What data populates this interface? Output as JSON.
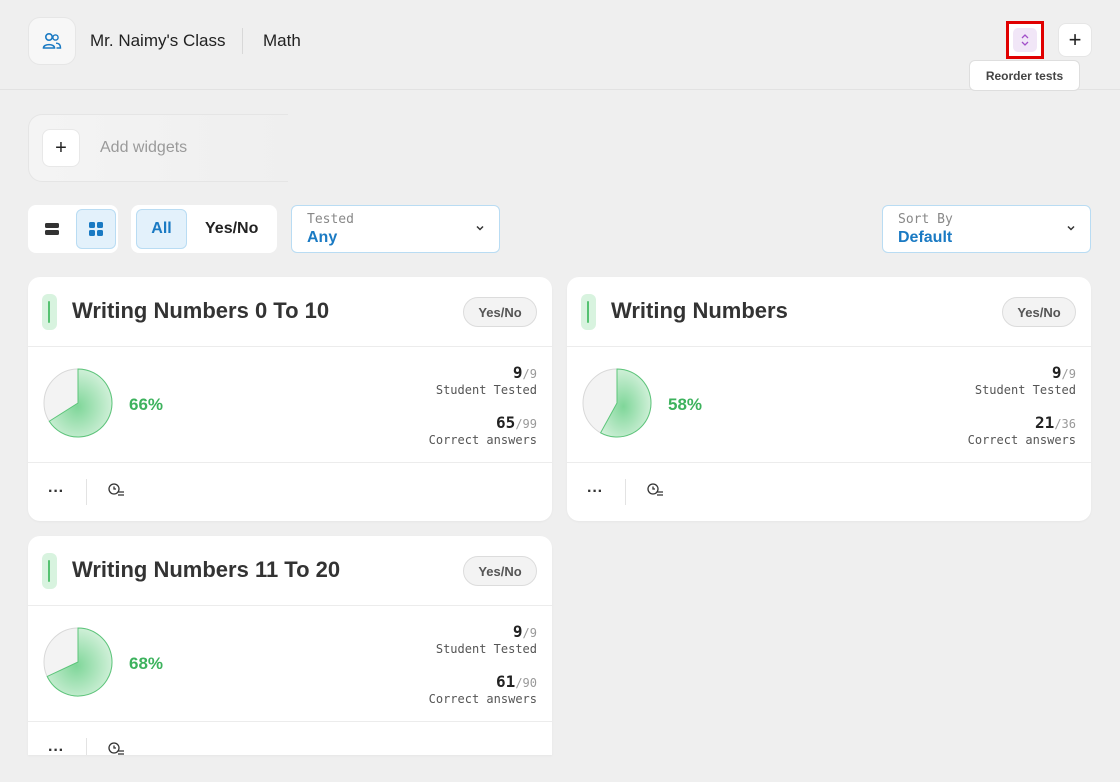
{
  "header": {
    "class_name": "Mr. Naimy's Class",
    "subject": "Math",
    "class_icon": "users-icon",
    "reorder_icon": "sort-vertical-icon",
    "reorder_tooltip": "Reorder tests",
    "add_label": "+"
  },
  "widgets": {
    "add_label": "+",
    "label": "Add widgets"
  },
  "filters": {
    "view_modes": [
      "list-view-icon",
      "grid-view-icon"
    ],
    "active_view": "grid",
    "type_options": [
      "All",
      "Yes/No"
    ],
    "active_type": "All",
    "tested": {
      "label": "Tested",
      "value": "Any"
    },
    "sort": {
      "label": "Sort By",
      "value": "Default"
    }
  },
  "cards": [
    {
      "title": "Writing Numbers 0 To 10",
      "badge": "Yes/No",
      "percent": 66,
      "percent_label": "66%",
      "students_tested": "9",
      "students_total": "/9",
      "students_label": "Student Tested",
      "correct": "65",
      "correct_total": "/99",
      "correct_label": "Correct answers",
      "more_label": "···"
    },
    {
      "title": "Writing Numbers",
      "badge": "Yes/No",
      "percent": 58,
      "percent_label": "58%",
      "students_tested": "9",
      "students_total": "/9",
      "students_label": "Student Tested",
      "correct": "21",
      "correct_total": "/36",
      "correct_label": "Correct answers",
      "more_label": "···"
    },
    {
      "title": "Writing Numbers 11 To 20",
      "badge": "Yes/No",
      "percent": 68,
      "percent_label": "68%",
      "students_tested": "9",
      "students_total": "/9",
      "students_label": "Student Tested",
      "correct": "61",
      "correct_total": "/90",
      "correct_label": "Correct answers",
      "more_label": "···"
    }
  ],
  "colors": {
    "accent": "#1a7ac3",
    "success": "#3db25d",
    "highlight_border": "#e00000"
  }
}
